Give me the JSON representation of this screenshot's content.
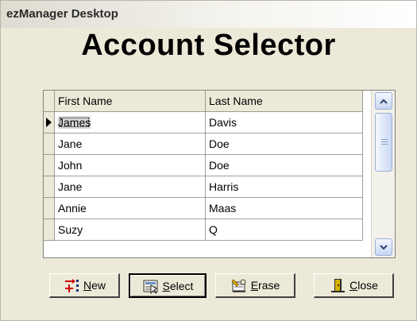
{
  "window": {
    "title": "ezManager Desktop"
  },
  "heading": "Account Selector",
  "grid": {
    "columns": [
      "First Name",
      "Last Name"
    ],
    "rows": [
      {
        "first": "James",
        "last": "Davis",
        "selected": true
      },
      {
        "first": "Jane",
        "last": "Doe",
        "selected": false
      },
      {
        "first": "John",
        "last": "Doe",
        "selected": false
      },
      {
        "first": "Jane",
        "last": "Harris",
        "selected": false
      },
      {
        "first": "Annie",
        "last": "Maas",
        "selected": false
      },
      {
        "first": "Suzy",
        "last": "Q",
        "selected": false
      }
    ]
  },
  "buttons": {
    "new": {
      "accel": "N",
      "rest": "ew",
      "icon": "new-record-icon"
    },
    "select": {
      "accel": "S",
      "rest": "elect",
      "icon": "select-icon"
    },
    "erase": {
      "accel": "E",
      "rest": "rase",
      "icon": "erase-icon"
    },
    "close": {
      "accel": "C",
      "rest": "lose",
      "icon": "door-exit-icon"
    }
  },
  "colors": {
    "window_bg": "#ece9d8",
    "grid_bg": "#ffffff",
    "scroll_accent": "#9bb0d6"
  }
}
